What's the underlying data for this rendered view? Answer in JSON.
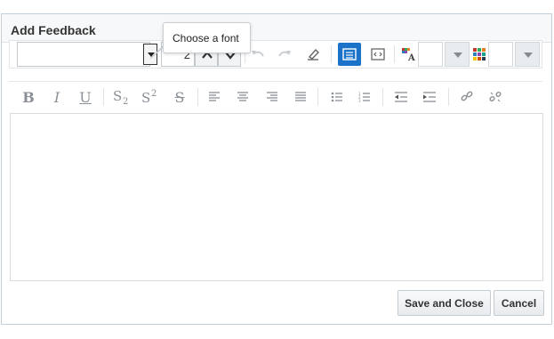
{
  "dialog": {
    "title": "Add Feedback"
  },
  "toolbar": {
    "font_value": "",
    "font_size_value": "2",
    "font_tooltip": "Choose a font",
    "text_color_value": "",
    "background_color_value": ""
  },
  "formatting": {
    "bold_label": "B",
    "italic_label": "I",
    "underline_label": "U",
    "subscript_label": "S2",
    "superscript_label": "S2",
    "strikethrough_label": "S"
  },
  "editor": {
    "content": ""
  },
  "actions": {
    "save_label": "Save and Close",
    "cancel_label": "Cancel"
  },
  "colors": {
    "accent_active": "#1a73c9",
    "header_bg": "#f7f8f9",
    "icon_gray": "#8a9096"
  }
}
